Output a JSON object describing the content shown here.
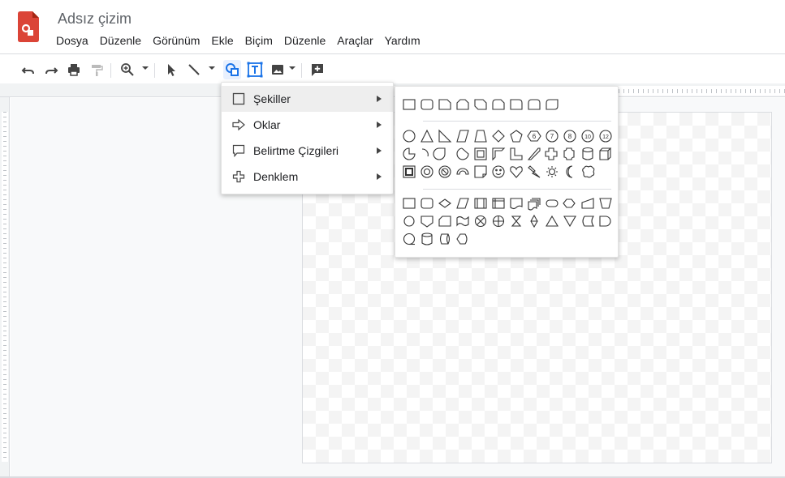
{
  "app": {
    "title": "Adsız çizim",
    "logo_icon": "google-drawings-logo",
    "brand_color": "#db4437"
  },
  "menubar": {
    "items": [
      "Dosya",
      "Düzenle",
      "Görünüm",
      "Ekle",
      "Biçim",
      "Düzenle",
      "Araçlar",
      "Yardım"
    ]
  },
  "toolbar": {
    "buttons": [
      {
        "name": "undo-icon"
      },
      {
        "name": "redo-icon"
      },
      {
        "name": "print-icon"
      },
      {
        "name": "paint-format-icon"
      },
      {
        "name": "zoom-icon"
      },
      {
        "name": "select-arrow-icon"
      },
      {
        "name": "line-icon"
      },
      {
        "name": "shape-icon",
        "active": true
      },
      {
        "name": "text-box-icon"
      },
      {
        "name": "image-icon"
      },
      {
        "name": "add-comment-icon"
      }
    ],
    "accent_color": "#1a73e8"
  },
  "dropdown": {
    "items": [
      {
        "label": "Şekiller",
        "icon": "square-icon",
        "selected": true
      },
      {
        "label": "Oklar",
        "icon": "arrow-icon",
        "selected": false
      },
      {
        "label": "Belirtme Çizgileri",
        "icon": "callout-icon",
        "selected": false
      },
      {
        "label": "Denklem",
        "icon": "plus-icon",
        "selected": false
      }
    ]
  },
  "shapes_submenu": {
    "groups": [
      {
        "name": "rectangles",
        "count": 9
      },
      {
        "name": "basic-shapes",
        "count": 32,
        "badge_numbers": [
          "6",
          "7",
          "8",
          "10",
          "12"
        ]
      },
      {
        "name": "flowchart",
        "count": 28
      }
    ]
  }
}
